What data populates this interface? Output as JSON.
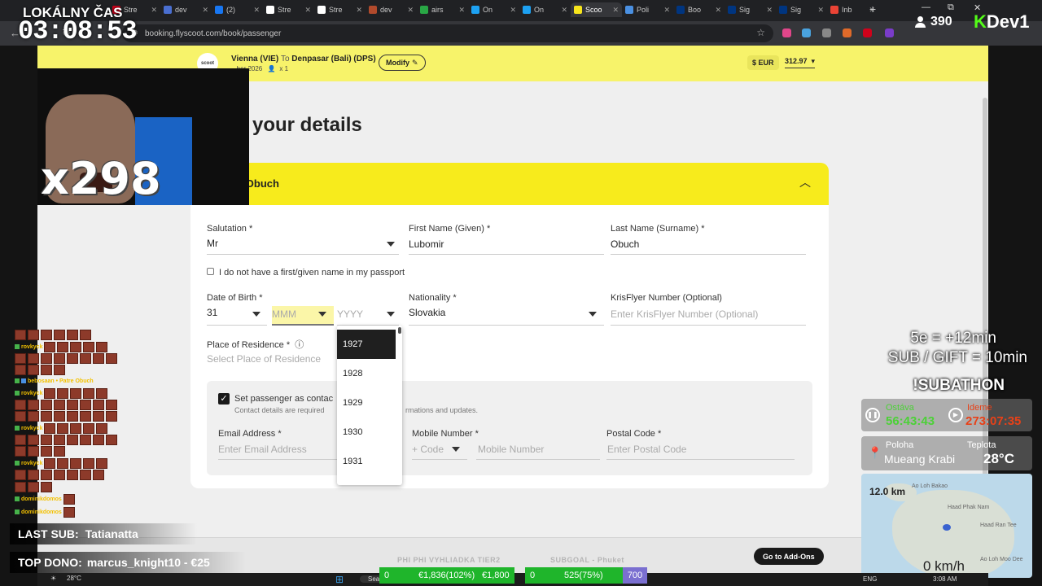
{
  "browser": {
    "tabs": [
      {
        "label": "Stre",
        "color": "#d0021b"
      },
      {
        "label": "dev",
        "color": "#4a6fd1"
      },
      {
        "label": "(2)",
        "color": "#1877f2"
      },
      {
        "label": "Stre",
        "color": "#ffffff"
      },
      {
        "label": "Stre",
        "color": "#ffffff"
      },
      {
        "label": "dev",
        "color": "#b14a2c"
      },
      {
        "label": "airs",
        "color": "#29a745"
      },
      {
        "label": "On",
        "color": "#1da1f2"
      },
      {
        "label": "On",
        "color": "#1da1f2"
      },
      {
        "label": "Scoo",
        "color": "#f7e51c"
      },
      {
        "label": "Poli",
        "color": "#4a90e2"
      },
      {
        "label": "Boo",
        "color": "#003580"
      },
      {
        "label": "Sig",
        "color": "#003580"
      },
      {
        "label": "Sig",
        "color": "#003580"
      },
      {
        "label": "Inb",
        "color": "#ea4335"
      }
    ],
    "url": "booking.flyscoot.com/book/passenger",
    "new_tab": "+",
    "window_controls": [
      "—",
      "⧉",
      "✕"
    ]
  },
  "header": {
    "logo": "scoot",
    "origin": "Vienna (VIE)",
    "to_word": "To",
    "destination": "Denpasar (Bali) (DPS)",
    "date": "...ber 2026",
    "pax": "x 1",
    "modify_label": "Modify",
    "currency": "$ EUR",
    "price": "312.97"
  },
  "form": {
    "title": "your details",
    "passenger_name": "omir Obuch",
    "salutation_label": "Salutation *",
    "salutation_value": "Mr",
    "first_name_label": "First Name (Given) *",
    "first_name_value": "Lubomir",
    "last_name_label": "Last Name (Surname) *",
    "last_name_value": "Obuch",
    "no_first_name": "I do not have a first/given name in my passport",
    "dob_label": "Date of Birth *",
    "dob_day": "31",
    "dob_month_ph": "MMM",
    "dob_year_ph": "YYYY",
    "nationality_label": "Nationality *",
    "nationality_value": "Slovakia",
    "krisflyer_label": "KrisFlyer Number (Optional)",
    "krisflyer_ph": "Enter KrisFlyer Number (Optional)",
    "residence_label": "Place of Residence *",
    "residence_ph": "Select Place of Residence",
    "contact_label": "Set passenger as contac",
    "contact_sub_a": "Contact details are required",
    "contact_sub_b": "rmations and updates.",
    "email_label": "Email Address *",
    "email_ph": "Enter Email Address",
    "mobile_label": "Mobile Number *",
    "code_ph": "+ Code",
    "mobile_ph": "Mobile Number",
    "postal_label": "Postal Code *",
    "postal_ph": "Enter Postal Code",
    "year_options": [
      "1927",
      "1928",
      "1929",
      "1930",
      "1931"
    ]
  },
  "bottom": {
    "goto_label": "Go to Add-Ons",
    "wm1": "PHI PHI VYHLIADKA TIER2",
    "wm2": "SUBGOAL - Phuket"
  },
  "stream": {
    "clock_label": "LOKÁLNY ČAS",
    "clock": "03:08:53",
    "multiplier": "x298",
    "viewers": "390",
    "brand_k": "K",
    "brand_rest": "Dev1",
    "sub_rule_1": "5e = +12min",
    "sub_rule_2": "SUB / GIFT = 10min",
    "subathon": "!SUBATHON",
    "remaining_label": "Ostáva",
    "remaining": "56:43:43",
    "elapsed_label": "Ideme",
    "elapsed": "273:07:35",
    "location_label": "Poloha",
    "location": "Mueang Krabi",
    "temp_label": "Teplota",
    "temp": "28°C",
    "map_distance": "12.0 km",
    "map_speed": "0 km/h",
    "map_labels": [
      "Ao Loh Bakao",
      "Haad Phak Nam",
      "Haad Ran Tee",
      "Ao Loh Moo Dee"
    ],
    "last_sub_label": "LAST SUB:",
    "last_sub": "Tatianatta",
    "top_dono_label": "TOP DONO:",
    "top_dono": "marcus_knight10 - €25",
    "chat_names": [
      "rovkyck",
      "bebosaan • Patre Obuch",
      "rovkyck",
      "rovkyck",
      "rovkyck",
      "dominikdomos",
      "dominikdomos"
    ],
    "goal_left": "0",
    "goal_amount": "€1,836(102%)",
    "goal_target": "€1,800",
    "goal2_left": "0",
    "goal2_amount": "525(75%)",
    "goal2_target": "700",
    "taskbar_temp": "28°C",
    "taskbar_search": "Search",
    "taskbar_lang": "ENG",
    "taskbar_time": "3:08 AM"
  }
}
